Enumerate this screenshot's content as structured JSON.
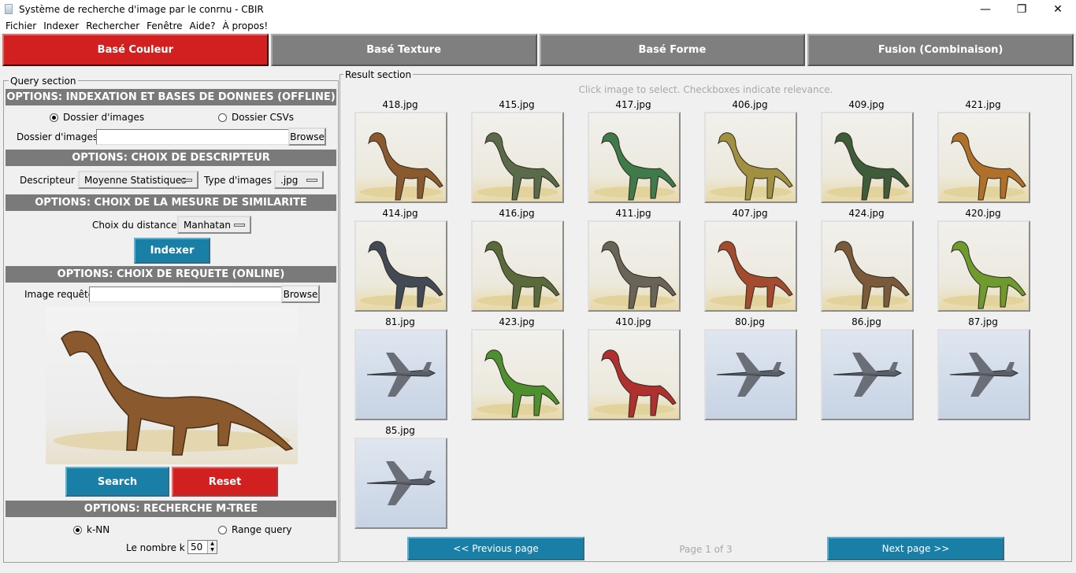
{
  "window": {
    "title": "Système de recherche d'image par le conrnu - CBIR",
    "minimize": "—",
    "maximize": "❐",
    "close": "✕"
  },
  "menu": [
    "Fichier",
    "Indexer",
    "Rechercher",
    "Fenêtre",
    "Aide?",
    "À propos!"
  ],
  "tabs": [
    {
      "label": "Basé Couleur",
      "active": true
    },
    {
      "label": "Basé Texture",
      "active": false
    },
    {
      "label": "Basé Forme",
      "active": false
    },
    {
      "label": "Fusion (Combinaison)",
      "active": false
    }
  ],
  "query": {
    "section_label": "Query section",
    "indexation": {
      "header": "OPTIONS: INDEXATION ET BASES DE DONNEES (OFFLINE)",
      "radio_images": "Dossier d'images",
      "radio_csv": "Dossier CSVs",
      "radio_images_selected": true,
      "folder_label": "Dossier d'images :",
      "folder_value": "",
      "browse": "Browse"
    },
    "descriptor": {
      "header": "OPTIONS: CHOIX DE DESCRIPTEUR",
      "desc_label": "Descripteur :",
      "desc_value": "Moyenne Statistiques",
      "type_label": "Type d'images :",
      "type_value": ".jpg"
    },
    "similarity": {
      "header": "OPTIONS: CHOIX DE LA MESURE DE SIMILARITE",
      "distance_label": "Choix du distance :",
      "distance_value": "Manhatan",
      "indexer_button": "Indexer"
    },
    "request": {
      "header": "OPTIONS: CHOIX DE REQUETE (ONLINE)",
      "image_label": "Image requête:",
      "image_value": "",
      "browse": "Browse",
      "search_button": "Search",
      "reset_button": "Reset"
    },
    "mtree": {
      "header": "OPTIONS: RECHERCHE M-TREE",
      "radio_knn": "k-NN",
      "radio_range": "Range query",
      "knn_selected": true,
      "count_label": "Le nombre k :",
      "count_value": "50"
    }
  },
  "results": {
    "section_label": "Result section",
    "hint": "Click image to select. Checkboxes indicate relevance.",
    "images": [
      {
        "name": "418.jpg",
        "kind": "dino"
      },
      {
        "name": "415.jpg",
        "kind": "dino"
      },
      {
        "name": "417.jpg",
        "kind": "dino"
      },
      {
        "name": "406.jpg",
        "kind": "dino"
      },
      {
        "name": "409.jpg",
        "kind": "dino"
      },
      {
        "name": "421.jpg",
        "kind": "dino"
      },
      {
        "name": "414.jpg",
        "kind": "dino"
      },
      {
        "name": "416.jpg",
        "kind": "dino"
      },
      {
        "name": "411.jpg",
        "kind": "dino"
      },
      {
        "name": "407.jpg",
        "kind": "dino"
      },
      {
        "name": "424.jpg",
        "kind": "dino"
      },
      {
        "name": "420.jpg",
        "kind": "dino"
      },
      {
        "name": "81.jpg",
        "kind": "plane"
      },
      {
        "name": "423.jpg",
        "kind": "dino"
      },
      {
        "name": "410.jpg",
        "kind": "dino"
      },
      {
        "name": "80.jpg",
        "kind": "plane"
      },
      {
        "name": "86.jpg",
        "kind": "plane"
      },
      {
        "name": "87.jpg",
        "kind": "plane"
      },
      {
        "name": "85.jpg",
        "kind": "plane"
      }
    ],
    "prev_button": "<< Previous page",
    "page_label": "Page 1 of 3",
    "next_button": "Next page >>"
  }
}
